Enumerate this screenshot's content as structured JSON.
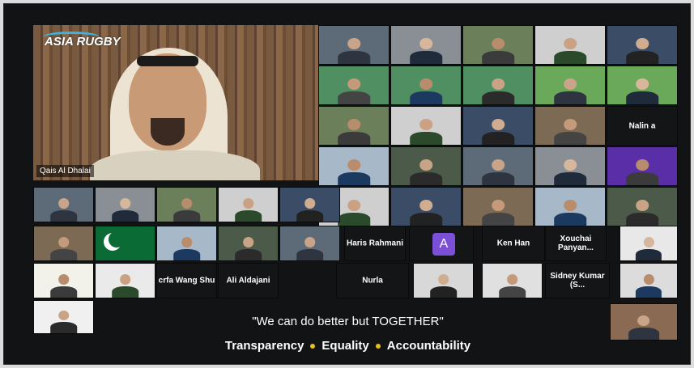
{
  "speaker": {
    "name": "Qais Al Dhalai",
    "logo_text": "ASIA RUGBY"
  },
  "colors": {
    "background": "#121314",
    "accent_dot": "#e6c020",
    "logo_arc": "#3fb3e0"
  },
  "name_tiles": [
    {
      "name": "Haris Rahmani"
    },
    {
      "name": "Ken Han"
    },
    {
      "name": "Xouchai Panyan..."
    },
    {
      "name": "crfa Wang Shu"
    },
    {
      "name": "Ali Aldajani"
    },
    {
      "name": "Nurla"
    },
    {
      "name": "Sidney Kumar (S..."
    },
    {
      "name": "Nalin a"
    }
  ],
  "avatar_letter": "A",
  "slogan": "\"We can do better but TOGETHER\"",
  "values": [
    "Transparency",
    "Equality",
    "Accountability"
  ]
}
